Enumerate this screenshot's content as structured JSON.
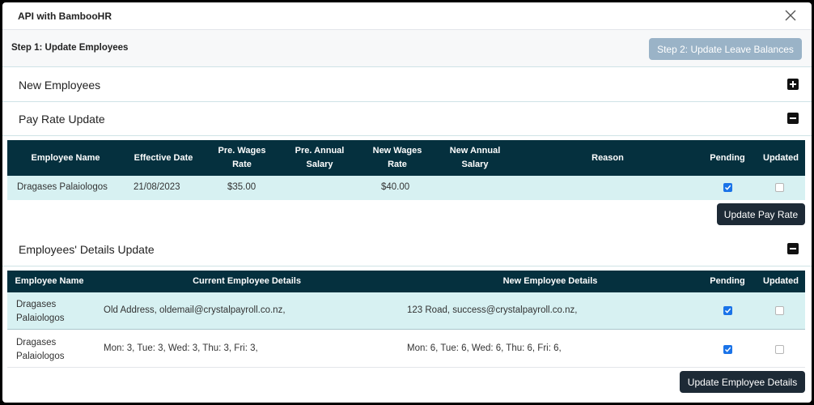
{
  "dialog": {
    "title": "API with BambooHR",
    "step1_label": "Step 1: Update Employees",
    "step2_button": "Step 2: Update Leave Balances"
  },
  "sections": {
    "new_employees": {
      "title": "New Employees",
      "icon": "plus-square-icon"
    },
    "pay_rate": {
      "title": "Pay Rate Update",
      "icon": "minus-square-icon",
      "headers": {
        "employee_name": "Employee Name",
        "effective_date": "Effective Date",
        "pre_wages_rate_1": "Pre. Wages",
        "pre_wages_rate_2": "Rate",
        "pre_annual_salary_1": "Pre. Annual",
        "pre_annual_salary_2": "Salary",
        "new_wages_rate_1": "New Wages",
        "new_wages_rate_2": "Rate",
        "new_annual_salary_1": "New Annual",
        "new_annual_salary_2": "Salary",
        "reason": "Reason",
        "pending": "Pending",
        "updated": "Updated"
      },
      "rows": [
        {
          "employee_name": "Dragases Palaiologos",
          "effective_date": "21/08/2023",
          "pre_wages_rate": "$35.00",
          "pre_annual_salary": "",
          "new_wages_rate": "$40.00",
          "new_annual_salary": "",
          "reason": "",
          "pending": true,
          "updated": false
        }
      ],
      "action_button": "Update Pay Rate"
    },
    "details": {
      "title": "Employees' Details Update",
      "icon": "minus-square-icon",
      "headers": {
        "employee_name": "Employee Name",
        "current_details": "Current Employee Details",
        "new_details": "New Employee Details",
        "pending": "Pending",
        "updated": "Updated"
      },
      "rows": [
        {
          "name_line1": "Dragases",
          "name_line2": "Palaiologos",
          "current_details": "Old Address, oldemail@crystalpayroll.co.nz,",
          "new_details": "123 Road, success@crystalpayroll.co.nz,",
          "pending": true,
          "updated": false
        },
        {
          "name_line1": "Dragases",
          "name_line2": "Palaiologos",
          "current_details": "Mon: 3, Tue: 3, Wed: 3, Thu: 3, Fri: 3,",
          "new_details": "Mon: 6, Tue: 6, Wed: 6, Thu: 6, Fri: 6,",
          "pending": true,
          "updated": false
        }
      ],
      "action_button": "Update Employee Details"
    }
  },
  "colors": {
    "table_header": "#05303e",
    "highlight_row": "#d7f1f2",
    "disabled_button": "#9ab3c7",
    "dark_button": "#1d2a36",
    "checkbox_checked": "#1a73e8"
  }
}
